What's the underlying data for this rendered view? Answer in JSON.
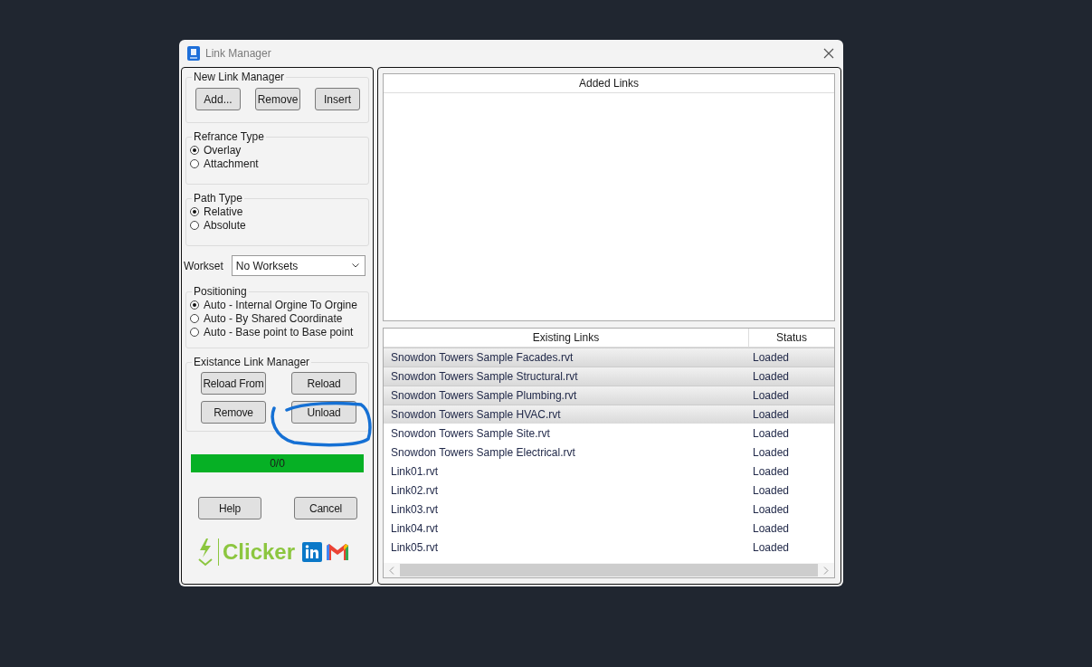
{
  "window": {
    "title": "Link Manager"
  },
  "new_link_manager": {
    "title": "New Link Manager",
    "buttons": [
      "Add...",
      "Remove",
      "Insert"
    ]
  },
  "reference_type": {
    "title": "Refrance Type",
    "options": [
      {
        "label": "Overlay",
        "selected": true
      },
      {
        "label": "Attachment",
        "selected": false
      }
    ]
  },
  "path_type": {
    "title": "Path Type",
    "options": [
      {
        "label": "Relative",
        "selected": true
      },
      {
        "label": "Absolute",
        "selected": false
      }
    ]
  },
  "workset": {
    "label": "Workset",
    "value": "No Worksets"
  },
  "positioning": {
    "title": "Positioning",
    "options": [
      {
        "label": "Auto - Internal Orgine To Orgine",
        "selected": true
      },
      {
        "label": "Auto - By Shared Coordinate",
        "selected": false
      },
      {
        "label": "Auto - Base point to Base point",
        "selected": false
      }
    ]
  },
  "existing_link_manager": {
    "title": "Existance Link Manager",
    "buttons": [
      "Reload From",
      "Reload",
      "Remove",
      "Unload"
    ]
  },
  "progress": {
    "level": 1,
    "reading": "0/0"
  },
  "footer_buttons": [
    "Help",
    "Cancel"
  ],
  "brand": {
    "name": "Clicker"
  },
  "added_links": {
    "title": "Added Links"
  },
  "existing_links": {
    "columns": [
      "Existing Links",
      "Status"
    ],
    "rows": [
      {
        "name": "Snowdon Towers Sample Facades.rvt",
        "status": "Loaded",
        "selected": true
      },
      {
        "name": "Snowdon Towers Sample Structural.rvt",
        "status": "Loaded",
        "selected": true
      },
      {
        "name": "Snowdon Towers Sample Plumbing.rvt",
        "status": "Loaded",
        "selected": true
      },
      {
        "name": "Snowdon Towers Sample HVAC.rvt",
        "status": "Loaded",
        "selected": true
      },
      {
        "name": "Snowdon Towers Sample Site.rvt",
        "status": "Loaded",
        "selected": false
      },
      {
        "name": "Snowdon Towers Sample Electrical.rvt",
        "status": "Loaded",
        "selected": false
      },
      {
        "name": "Link01.rvt",
        "status": "Loaded",
        "selected": false
      },
      {
        "name": "Link02.rvt",
        "status": "Loaded",
        "selected": false
      },
      {
        "name": "Link03.rvt",
        "status": "Loaded",
        "selected": false
      },
      {
        "name": "Link04.rvt",
        "status": "Loaded",
        "selected": false
      },
      {
        "name": "Link05.rvt",
        "status": "Loaded",
        "selected": false
      }
    ]
  }
}
